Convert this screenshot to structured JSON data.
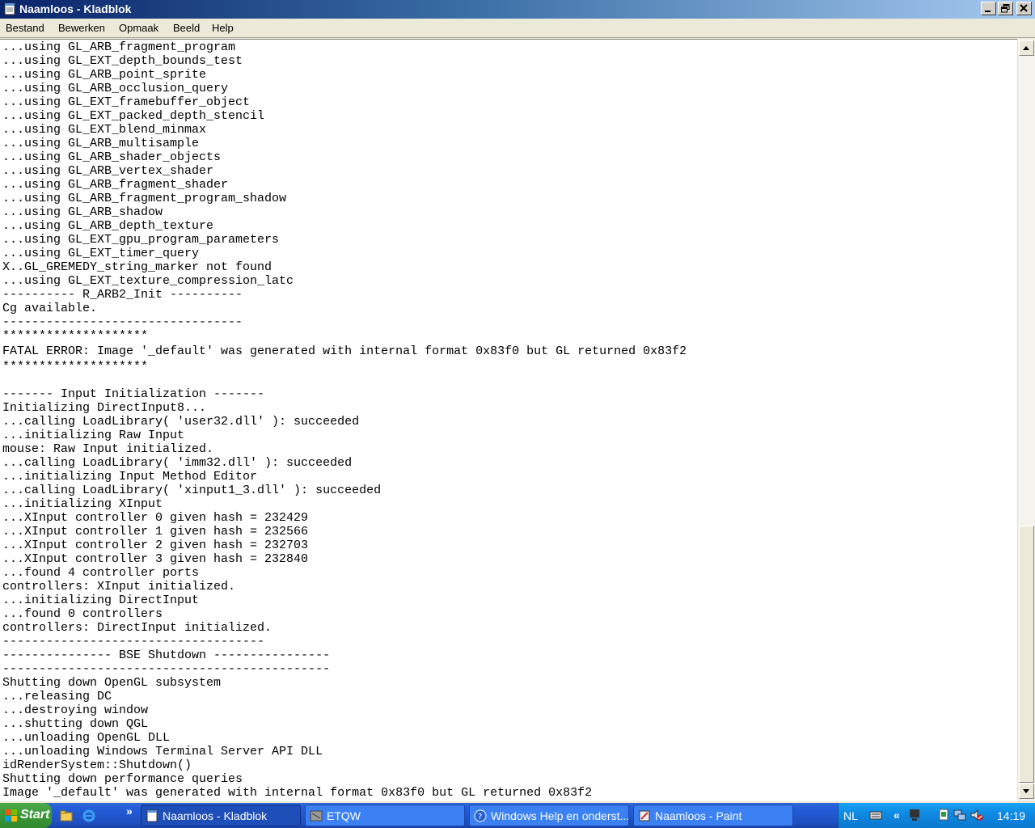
{
  "window": {
    "title": "Naamloos - Kladblok"
  },
  "menu": [
    "Bestand",
    "Bewerken",
    "Opmaak",
    "Beeld",
    "Help"
  ],
  "lines": [
    "...using GL_ARB_fragment_program",
    "...using GL_EXT_depth_bounds_test",
    "...using GL_ARB_point_sprite",
    "...using GL_ARB_occlusion_query",
    "...using GL_EXT_framebuffer_object",
    "...using GL_EXT_packed_depth_stencil",
    "...using GL_EXT_blend_minmax",
    "...using GL_ARB_multisample",
    "...using GL_ARB_shader_objects",
    "...using GL_ARB_vertex_shader",
    "...using GL_ARB_fragment_shader",
    "...using GL_ARB_fragment_program_shadow",
    "...using GL_ARB_shadow",
    "...using GL_ARB_depth_texture",
    "...using GL_EXT_gpu_program_parameters",
    "...using GL_EXT_timer_query",
    "X..GL_GREMEDY_string_marker not found",
    "...using GL_EXT_texture_compression_latc",
    "---------- R_ARB2_Init ----------",
    "Cg available.",
    "---------------------------------",
    "********************",
    "FATAL ERROR: Image '_default' was generated with internal format 0x83f0 but GL returned 0x83f2",
    "********************",
    "",
    "------- Input Initialization -------",
    "Initializing DirectInput8...",
    "...calling LoadLibrary( 'user32.dll' ): succeeded",
    "...initializing Raw Input",
    "mouse: Raw Input initialized.",
    "...calling LoadLibrary( 'imm32.dll' ): succeeded",
    "...initializing Input Method Editor",
    "...calling LoadLibrary( 'xinput1_3.dll' ): succeeded",
    "...initializing XInput",
    "...XInput controller 0 given hash = 232429",
    "...XInput controller 1 given hash = 232566",
    "...XInput controller 2 given hash = 232703",
    "...XInput controller 3 given hash = 232840",
    "...found 4 controller ports",
    "controllers: XInput initialized.",
    "...initializing DirectInput",
    "...found 0 controllers",
    "controllers: DirectInput initialized.",
    "------------------------------------",
    "--------------- BSE Shutdown ----------------",
    "---------------------------------------------",
    "Shutting down OpenGL subsystem",
    "...releasing DC",
    "...destroying window",
    "...shutting down QGL",
    "...unloading OpenGL DLL",
    "...unloading Windows Terminal Server API DLL",
    "idRenderSystem::Shutdown()",
    "Shutting down performance queries",
    "Image '_default' was generated with internal format 0x83f0 but GL returned 0x83f2"
  ],
  "taskbar": {
    "start_label": "Start",
    "tasks": [
      {
        "label": "Naamloos - Kladblok",
        "icon": "notepad-icon",
        "active": true
      },
      {
        "label": "ETQW",
        "icon": "etqw-icon",
        "active": false
      },
      {
        "label": "Windows Help en onderst...",
        "icon": "help-icon",
        "active": false
      },
      {
        "label": "Naamloos - Paint",
        "icon": "paint-icon",
        "active": false
      }
    ],
    "language": "NL",
    "clock": "14:19"
  }
}
